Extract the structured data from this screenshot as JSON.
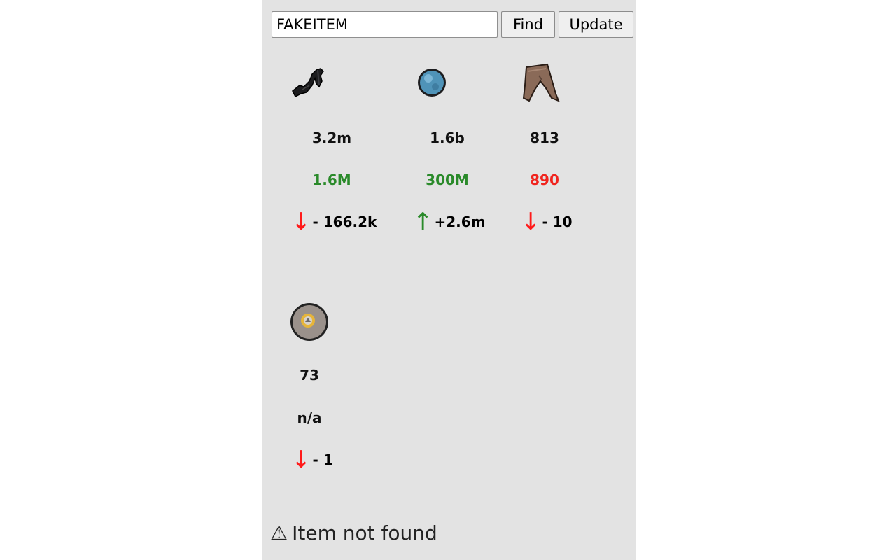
{
  "search": {
    "value": "FAKEITEM",
    "placeholder": ""
  },
  "buttons": {
    "find": "Find",
    "update": "Update"
  },
  "items": [
    {
      "icon": "dark-bow-icon",
      "price": "3.2m",
      "volume": "1.6M",
      "volume_color": "#2a8a2a",
      "direction": "down",
      "arrow": "↓",
      "change": "- 166.2k"
    },
    {
      "icon": "blue-orb-icon",
      "price": "1.6b",
      "volume": "300M",
      "volume_color": "#2a8a2a",
      "direction": "up",
      "arrow": "↑",
      "change": "+2.6m"
    },
    {
      "icon": "leather-chaps-icon",
      "price": "813",
      "volume": "890",
      "volume_color": "#f0241e",
      "direction": "down",
      "arrow": "↓",
      "change": "- 10"
    },
    {
      "icon": "coin-token-icon",
      "price": "73",
      "volume": "n/a",
      "volume_color": "#111111",
      "direction": "down",
      "arrow": "↓",
      "change": "- 1"
    }
  ],
  "status": {
    "icon": "warning-icon",
    "glyph": "⚠",
    "text": "Item not found"
  }
}
